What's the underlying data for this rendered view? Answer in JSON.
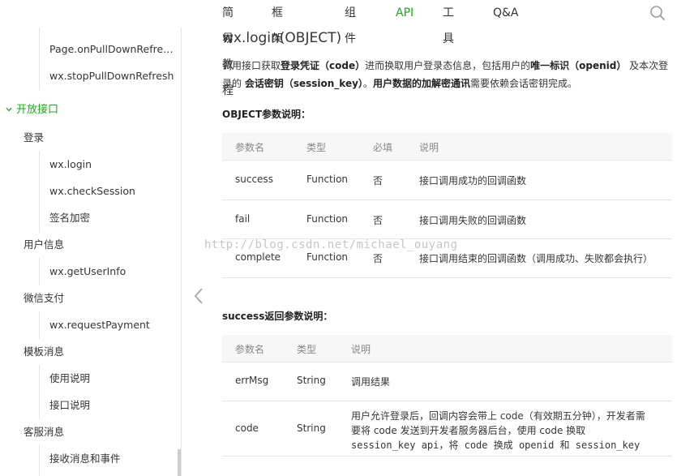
{
  "nav": {
    "items": [
      {
        "label": "简易教程",
        "active": false
      },
      {
        "label": "框架",
        "active": false
      },
      {
        "label": "组件",
        "active": false
      },
      {
        "label": "API",
        "active": true
      },
      {
        "label": "工具",
        "active": false
      },
      {
        "label": "Q&A",
        "active": false
      }
    ],
    "search_icon": "search-icon",
    "accent": "#1aad19"
  },
  "sidebar": {
    "items": [
      {
        "label": "Page.onPullDownRefre…",
        "level": 3
      },
      {
        "label": "wx.stopPullDownRefresh",
        "level": 3
      },
      {
        "label": "开放接口",
        "level": 1
      },
      {
        "label": "登录",
        "level": 2
      },
      {
        "label": "wx.login",
        "level": 3
      },
      {
        "label": "wx.checkSession",
        "level": 3
      },
      {
        "label": "签名加密",
        "level": 3
      },
      {
        "label": "用户信息",
        "level": 2
      },
      {
        "label": "wx.getUserInfo",
        "level": 3
      },
      {
        "label": "微信支付",
        "level": 2
      },
      {
        "label": "wx.requestPayment",
        "level": 3
      },
      {
        "label": "模板消息",
        "level": 2
      },
      {
        "label": "使用说明",
        "level": 3
      },
      {
        "label": "接口说明",
        "level": 3
      },
      {
        "label": "客服消息",
        "level": 2
      },
      {
        "label": "接收消息和事件",
        "level": 3
      }
    ]
  },
  "main": {
    "title": "wx.login(OBJECT)",
    "intro": {
      "p1": "调用接口获取",
      "b1": "登录凭证（code）",
      "p2": "进而换取用户登录态信息，包括用户的",
      "b2": "唯一标识（openid）",
      "p3": " 及本次登录的 ",
      "b3": "会话密钥（session_key）",
      "p4": "。",
      "b4": "用户数据的加解密通讯",
      "p5": "需要依赖会话密钥完成。"
    },
    "object_heading": "OBJECT参数说明：",
    "object_table": {
      "headers": [
        "参数名",
        "类型",
        "必填",
        "说明"
      ],
      "rows": [
        [
          "success",
          "Function",
          "否",
          "接口调用成功的回调函数"
        ],
        [
          "fail",
          "Function",
          "否",
          "接口调用失败的回调函数"
        ],
        [
          "complete",
          "Function",
          "否",
          "接口调用结束的回调函数（调用成功、失败都会执行）"
        ]
      ]
    },
    "success_heading": "success返回参数说明：",
    "success_table": {
      "headers": [
        "参数名",
        "类型",
        "说明"
      ],
      "rows": [
        {
          "name": "errMsg",
          "type": "String",
          "desc": [
            "调用结果"
          ]
        },
        {
          "name": "code",
          "type": "String",
          "desc": [
            "用户允许登录后，回调内容会带上 code（有效期五分钟），开发者需",
            "要将 code 发送到开发者服务器后台，使用 code 换取",
            "session_key api，将 code 换成 openid 和 session_key"
          ]
        }
      ]
    }
  },
  "watermark": "http://blog.csdn.net/michael_ouyang"
}
